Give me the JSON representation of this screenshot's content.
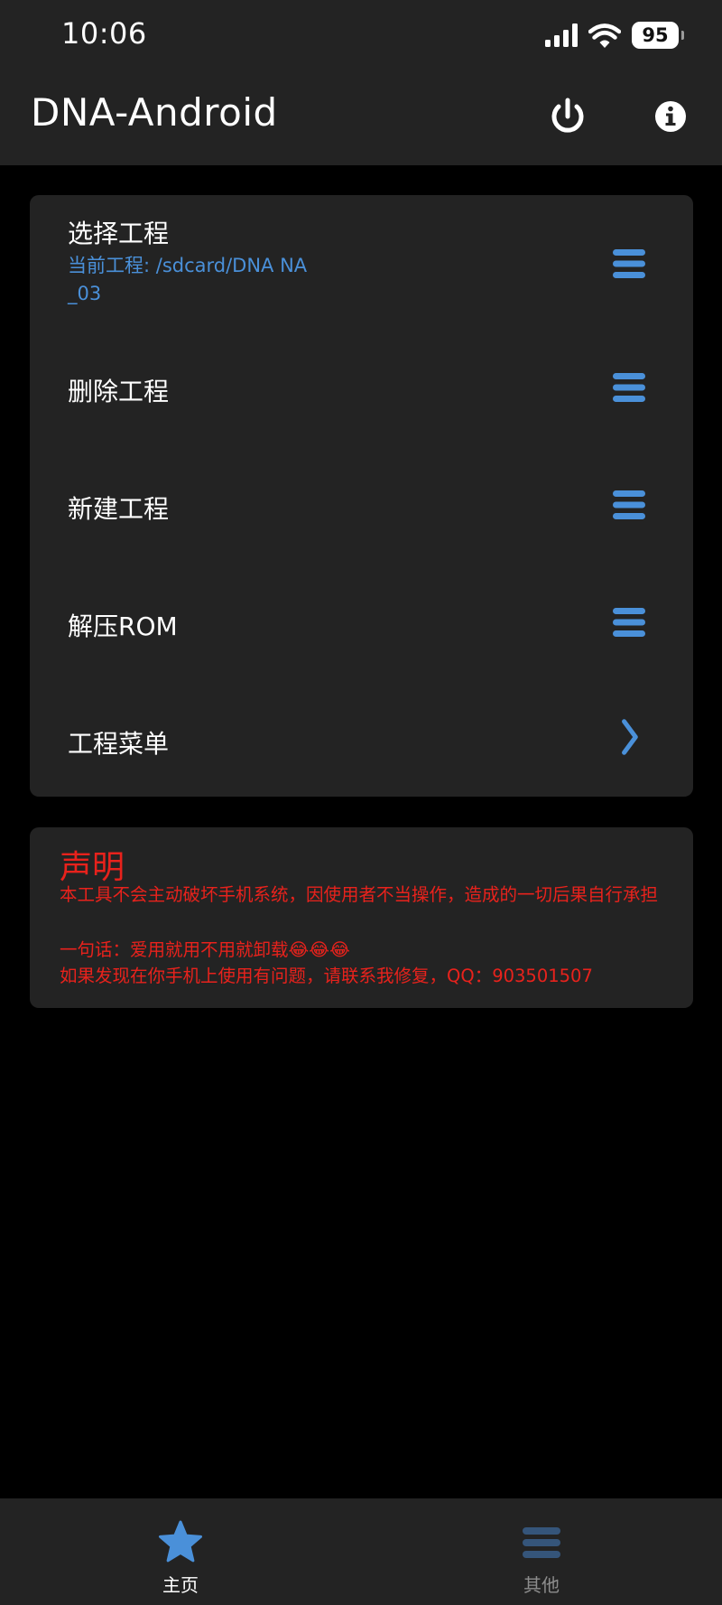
{
  "status_bar": {
    "time": "10:06",
    "battery": "95",
    "icons": [
      "signal-icon",
      "wifi-icon",
      "battery-icon"
    ]
  },
  "app_bar": {
    "title": "DNA-Android",
    "actions": [
      "power-icon",
      "info-icon"
    ]
  },
  "menu": {
    "items": [
      {
        "label": "选择工程",
        "sub": "当前工程: /sdcard/DNA NA_03",
        "icon": "menu-icon"
      },
      {
        "label": "删除工程",
        "icon": "menu-icon"
      },
      {
        "label": "新建工程",
        "icon": "menu-icon"
      },
      {
        "label": "解压ROM",
        "icon": "menu-icon"
      },
      {
        "label": "工程菜单",
        "icon": "chevron-right-icon"
      }
    ]
  },
  "notice": {
    "title": "声明",
    "lines": [
      "本工具不会主动破坏手机系统，因使用者不当操作，造成的一切后果自行承担",
      "一句话：爱用就用不用就卸载😂😂😂",
      "如果发现在你手机上使用有问题，请联系我修复，QQ：903501507"
    ]
  },
  "bottom_nav": {
    "tabs": [
      {
        "label": "主页",
        "icon": "star-icon",
        "active": true
      },
      {
        "label": "其他",
        "icon": "menu-icon",
        "active": false
      }
    ]
  },
  "colors": {
    "accent": "#4a90d9",
    "warning": "#e8221c",
    "surface": "#232323",
    "background": "#000000",
    "inactive": "#8c8c8c"
  }
}
